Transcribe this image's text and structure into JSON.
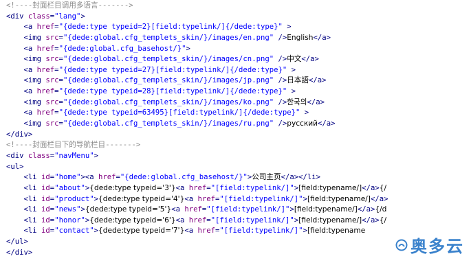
{
  "colors": {
    "comment": "#8b8b8b",
    "tag": "#000080",
    "attribute": "#800080",
    "string": "#0000ff",
    "text": "#000000",
    "watermark": "#2a78c8"
  },
  "code_lines": [
    [
      {
        "t": "<!----封面栏目调用多语言------->",
        "k": "comment"
      }
    ],
    [
      {
        "t": "<div ",
        "k": "tag"
      },
      {
        "t": "class",
        "k": "attr"
      },
      {
        "t": "=",
        "k": "punct"
      },
      {
        "t": "\"lang\"",
        "k": "str"
      },
      {
        "t": ">",
        "k": "tag"
      }
    ],
    [
      {
        "t": "    <a ",
        "k": "tag"
      },
      {
        "t": "href",
        "k": "attr"
      },
      {
        "t": "=",
        "k": "punct"
      },
      {
        "t": "\"{dede:type typeid=2}[field:typelink/]{/dede:type}\"",
        "k": "str"
      },
      {
        "t": " >",
        "k": "tag"
      }
    ],
    [
      {
        "t": "    <img ",
        "k": "tag"
      },
      {
        "t": "src",
        "k": "attr"
      },
      {
        "t": "=",
        "k": "punct"
      },
      {
        "t": "\"{dede:global.cfg_templets_skin/}/images/en.png\"",
        "k": "str"
      },
      {
        "t": " />",
        "k": "tag"
      },
      {
        "t": "English",
        "k": "text"
      },
      {
        "t": "</a>",
        "k": "tag"
      }
    ],
    [
      {
        "t": "    <a ",
        "k": "tag"
      },
      {
        "t": "href",
        "k": "attr"
      },
      {
        "t": "=",
        "k": "punct"
      },
      {
        "t": "\"{dede:global.cfg_basehost/}\"",
        "k": "str"
      },
      {
        "t": ">",
        "k": "tag"
      }
    ],
    [
      {
        "t": "    <img ",
        "k": "tag"
      },
      {
        "t": "src",
        "k": "attr"
      },
      {
        "t": "=",
        "k": "punct"
      },
      {
        "t": "\"{dede:global.cfg_templets_skin/}/images/cn.png\"",
        "k": "str"
      },
      {
        "t": " />",
        "k": "tag"
      },
      {
        "t": "中文",
        "k": "text"
      },
      {
        "t": "</a>",
        "k": "tag"
      }
    ],
    [
      {
        "t": "    <a ",
        "k": "tag"
      },
      {
        "t": "href",
        "k": "attr"
      },
      {
        "t": "=",
        "k": "punct"
      },
      {
        "t": "\"{dede:type typeid=27}[field:typelink/]{/dede:type}\"",
        "k": "str"
      },
      {
        "t": " >",
        "k": "tag"
      }
    ],
    [
      {
        "t": "    <img ",
        "k": "tag"
      },
      {
        "t": "src",
        "k": "attr"
      },
      {
        "t": "=",
        "k": "punct"
      },
      {
        "t": "\"{dede:global.cfg_templets_skin/}/images/jp.png\"",
        "k": "str"
      },
      {
        "t": " />",
        "k": "tag"
      },
      {
        "t": "日本語",
        "k": "text"
      },
      {
        "t": "</a>",
        "k": "tag"
      }
    ],
    [
      {
        "t": "    <a ",
        "k": "tag"
      },
      {
        "t": "href",
        "k": "attr"
      },
      {
        "t": "=",
        "k": "punct"
      },
      {
        "t": "\"{dede:type typeid=28}[field:typelink/]{/dede:type}\"",
        "k": "str"
      },
      {
        "t": " >",
        "k": "tag"
      }
    ],
    [
      {
        "t": "    <img ",
        "k": "tag"
      },
      {
        "t": "src",
        "k": "attr"
      },
      {
        "t": "=",
        "k": "punct"
      },
      {
        "t": "\"{dede:global.cfg_templets_skin/}/images/ko.png\"",
        "k": "str"
      },
      {
        "t": " />",
        "k": "tag"
      },
      {
        "t": "한국의",
        "k": "text"
      },
      {
        "t": "</a>",
        "k": "tag"
      }
    ],
    [
      {
        "t": "    <a ",
        "k": "tag"
      },
      {
        "t": "href",
        "k": "attr"
      },
      {
        "t": "=",
        "k": "punct"
      },
      {
        "t": "\"{dede:type typeid=63495}[field:typelink/]{/dede:type}\"",
        "k": "str"
      },
      {
        "t": " >",
        "k": "tag"
      }
    ],
    [
      {
        "t": "    <img ",
        "k": "tag"
      },
      {
        "t": "src",
        "k": "attr"
      },
      {
        "t": "=",
        "k": "punct"
      },
      {
        "t": "\"{dede:global.cfg_templets_skin/}/images/ru.png\"",
        "k": "str"
      },
      {
        "t": " />",
        "k": "tag"
      },
      {
        "t": "русский",
        "k": "text"
      },
      {
        "t": "</a>",
        "k": "tag"
      }
    ],
    [
      {
        "t": "</div>",
        "k": "tag"
      }
    ],
    [
      {
        "t": "<!----封面栏目下的导航栏目------->",
        "k": "comment"
      }
    ],
    [
      {
        "t": "<div ",
        "k": "tag"
      },
      {
        "t": "class",
        "k": "attr"
      },
      {
        "t": "=",
        "k": "punct"
      },
      {
        "t": "\"navMenu\"",
        "k": "str"
      },
      {
        "t": ">",
        "k": "tag"
      }
    ],
    [
      {
        "t": "<ul>",
        "k": "tag"
      }
    ],
    [
      {
        "t": "    <li ",
        "k": "tag"
      },
      {
        "t": "id",
        "k": "attr"
      },
      {
        "t": "=",
        "k": "punct"
      },
      {
        "t": "\"home\"",
        "k": "str"
      },
      {
        "t": "><a ",
        "k": "tag"
      },
      {
        "t": "href",
        "k": "attr"
      },
      {
        "t": "=",
        "k": "punct"
      },
      {
        "t": "\"{dede:global.cfg_basehost/}\"",
        "k": "str"
      },
      {
        "t": ">",
        "k": "tag"
      },
      {
        "t": "公司主页",
        "k": "text"
      },
      {
        "t": "</a></li>",
        "k": "tag"
      }
    ],
    [
      {
        "t": "    <li ",
        "k": "tag"
      },
      {
        "t": "id",
        "k": "attr"
      },
      {
        "t": "=",
        "k": "punct"
      },
      {
        "t": "\"about\"",
        "k": "str"
      },
      {
        "t": ">",
        "k": "tag"
      },
      {
        "t": "{dede:type typeid='3'}",
        "k": "text"
      },
      {
        "t": "<a ",
        "k": "tag"
      },
      {
        "t": "href",
        "k": "attr"
      },
      {
        "t": "=",
        "k": "punct"
      },
      {
        "t": "\"[field:typelink/]\"",
        "k": "str"
      },
      {
        "t": ">",
        "k": "tag"
      },
      {
        "t": "[field:typename/]",
        "k": "text"
      },
      {
        "t": "</a>",
        "k": "tag"
      },
      {
        "t": "{/",
        "k": "text"
      }
    ],
    [
      {
        "t": "    <li ",
        "k": "tag"
      },
      {
        "t": "id",
        "k": "attr"
      },
      {
        "t": "=",
        "k": "punct"
      },
      {
        "t": "\"product\"",
        "k": "str"
      },
      {
        "t": ">",
        "k": "tag"
      },
      {
        "t": "{dede:type typeid='4'}",
        "k": "text"
      },
      {
        "t": "<a ",
        "k": "tag"
      },
      {
        "t": "href",
        "k": "attr"
      },
      {
        "t": "=",
        "k": "punct"
      },
      {
        "t": "\"[field:typelink/]\"",
        "k": "str"
      },
      {
        "t": ">",
        "k": "tag"
      },
      {
        "t": "[field:typename/]",
        "k": "text"
      },
      {
        "t": "</a>",
        "k": "tag"
      }
    ],
    [
      {
        "t": "    <li ",
        "k": "tag"
      },
      {
        "t": "id",
        "k": "attr"
      },
      {
        "t": "=",
        "k": "punct"
      },
      {
        "t": "\"news\"",
        "k": "str"
      },
      {
        "t": ">",
        "k": "tag"
      },
      {
        "t": "{dede:type typeid='5'}",
        "k": "text"
      },
      {
        "t": "<a ",
        "k": "tag"
      },
      {
        "t": "href",
        "k": "attr"
      },
      {
        "t": "=",
        "k": "punct"
      },
      {
        "t": "\"[field:typelink/]\"",
        "k": "str"
      },
      {
        "t": ">",
        "k": "tag"
      },
      {
        "t": "[field:typename/]",
        "k": "text"
      },
      {
        "t": "</a>",
        "k": "tag"
      },
      {
        "t": "{/d",
        "k": "text"
      }
    ],
    [
      {
        "t": "    <li ",
        "k": "tag"
      },
      {
        "t": "id",
        "k": "attr"
      },
      {
        "t": "=",
        "k": "punct"
      },
      {
        "t": "\"honor\"",
        "k": "str"
      },
      {
        "t": ">",
        "k": "tag"
      },
      {
        "t": "{dede:type typeid='6'}",
        "k": "text"
      },
      {
        "t": "<a ",
        "k": "tag"
      },
      {
        "t": "href",
        "k": "attr"
      },
      {
        "t": "=",
        "k": "punct"
      },
      {
        "t": "\"[field:typelink/]\"",
        "k": "str"
      },
      {
        "t": ">",
        "k": "tag"
      },
      {
        "t": "[field:typename/]",
        "k": "text"
      },
      {
        "t": "</a>",
        "k": "tag"
      },
      {
        "t": "{/",
        "k": "text"
      }
    ],
    [
      {
        "t": "    <li ",
        "k": "tag"
      },
      {
        "t": "id",
        "k": "attr"
      },
      {
        "t": "=",
        "k": "punct"
      },
      {
        "t": "\"contact\"",
        "k": "str"
      },
      {
        "t": ">",
        "k": "tag"
      },
      {
        "t": "{dede:type typeid='7'}",
        "k": "text"
      },
      {
        "t": "<a ",
        "k": "tag"
      },
      {
        "t": "href",
        "k": "attr"
      },
      {
        "t": "=",
        "k": "punct"
      },
      {
        "t": "\"[field:typelink/]\"",
        "k": "str"
      },
      {
        "t": ">",
        "k": "tag"
      },
      {
        "t": "[field:typename",
        "k": "text"
      }
    ],
    [
      {
        "t": "</ul>",
        "k": "tag"
      }
    ],
    [
      {
        "t": "</div>",
        "k": "tag"
      }
    ]
  ],
  "watermark": {
    "text": "奥多云",
    "icon": "cloud-logo-icon"
  }
}
